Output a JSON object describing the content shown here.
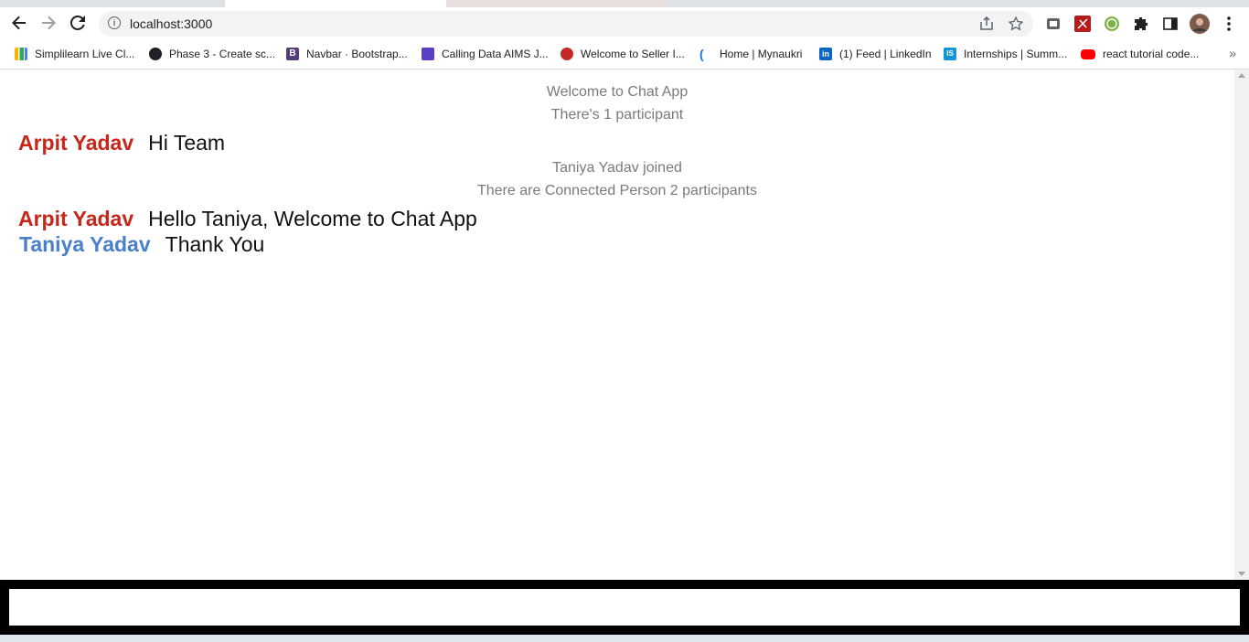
{
  "browser": {
    "url": "localhost:3000",
    "bookmarks": [
      {
        "label": "Simplilearn Live Cl...",
        "icon": "simplilearn-icon",
        "color": "#f4b400"
      },
      {
        "label": "Phase 3 - Create sc...",
        "icon": "globe-icon",
        "color": "#202124"
      },
      {
        "label": "Navbar · Bootstrap...",
        "icon": "bootstrap-icon",
        "color": "#563d7c"
      },
      {
        "label": "Calling Data AIMS J...",
        "icon": "list-icon",
        "color": "#5c3ec4"
      },
      {
        "label": "Welcome to Seller I...",
        "icon": "seller-icon",
        "color": "#c62828"
      },
      {
        "label": "Home | Mynaukri",
        "icon": "mynaukri-icon",
        "color": "#1a73e8"
      },
      {
        "label": "(1) Feed | LinkedIn",
        "icon": "linkedin-icon",
        "color": "#0a66c2"
      },
      {
        "label": "Internships | Summ...",
        "icon": "internshala-icon",
        "color": "#1295d8"
      },
      {
        "label": "react tutorial code...",
        "icon": "youtube-icon",
        "color": "#ff0000"
      }
    ]
  },
  "chat": {
    "welcome": "Welcome to Chat App",
    "participants_initial": "There's 1 participant",
    "messages": [
      {
        "sender": "Arpit Yadav",
        "text": "Hi Team"
      },
      {
        "sender": "Arpit Yadav",
        "text": "Hello Taniya, Welcome to Chat App"
      },
      {
        "sender": "Taniya Yadav",
        "text": "Thank You"
      }
    ],
    "join_notice": "Taniya Yadav joined",
    "participants_after": "There are Connected Person 2 participants",
    "input_value": "",
    "colors": {
      "arpit": "#c7261a",
      "taniya": "#4a7fcb"
    }
  }
}
